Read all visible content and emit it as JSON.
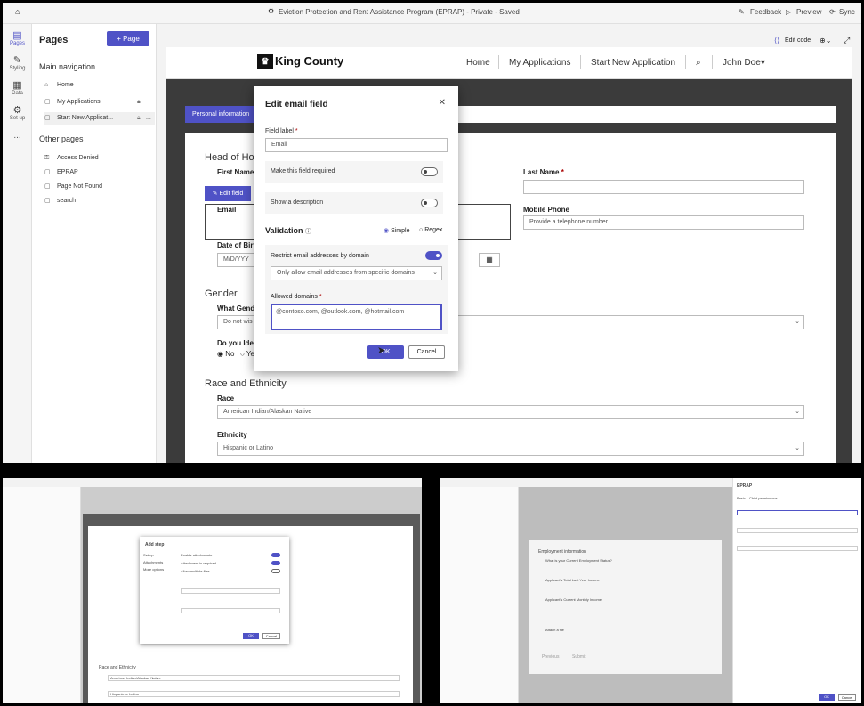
{
  "topbar": {
    "title": "Eviction Protection and Rent Assistance Program (EPRAP) - Private - Saved",
    "feedback": "Feedback",
    "preview": "Preview",
    "sync": "Sync"
  },
  "rail": {
    "pages": "Pages",
    "styling": "Styling",
    "data": "Data",
    "setup": "Set up",
    "more": "..."
  },
  "pages_panel": {
    "title": "Pages",
    "add_button": "+ Page",
    "main_nav": "Main navigation",
    "main_items": [
      "Home",
      "My Applications",
      "Start New Applicat..."
    ],
    "more_icon": "...",
    "other": "Other pages",
    "other_items": [
      "Access Denied",
      "EPRAP",
      "Page Not Found",
      "search"
    ]
  },
  "canvas": {
    "edit_code": "Edit code",
    "logo": "King County",
    "nav": [
      "Home",
      "My Applications",
      "Start New Application"
    ],
    "user": "John Doe",
    "step_tab": "Personal information"
  },
  "form": {
    "head": "Head of Hous",
    "first_name": "First Name",
    "edit_field": "Edit field",
    "last_name": "Last Name",
    "required": "*",
    "email": "Email",
    "mobile_phone": "Mobile Phone",
    "mobile_placeholder": "Provide a telephone number",
    "dob": "Date of Birt",
    "dob_placeholder": "M/D/YYY",
    "gender_section": "Gender",
    "gender_q": "What Gend",
    "gender_value": "Do not wis",
    "trans_q": "Do you Ide",
    "no": "No",
    "yes": "Ye",
    "race_section": "Race and Ethnicity",
    "race": "Race",
    "race_value": "American Indian/Alaskan Native",
    "ethnicity": "Ethnicity",
    "ethnicity_value": "Hispanic or Latino"
  },
  "dialog": {
    "title": "Edit email field",
    "field_label": "Field label",
    "field_value": "Email",
    "required_toggle": "Make this field required",
    "desc_toggle": "Show a description",
    "validation": "Validation",
    "simple": "Simple",
    "regex": "Regex",
    "restrict": "Restrict email addresses by domain",
    "dropdown": "Only allow email addresses from specific domains",
    "allowed_domains": "Allowed domains",
    "domains_value": "@contoso.com, @outlook.com, @hotmail.com",
    "ok": "OK",
    "cancel": "Cancel"
  },
  "thumb1": {
    "dialog_title": "Add step",
    "tabs": [
      "Set up",
      "Attachments",
      "More options"
    ],
    "rows": [
      "Enable attachments",
      "Attachment is required",
      "Allow multiple files"
    ],
    "ok": "OK",
    "cancel": "Cancel",
    "section": "Race and Ethnicity",
    "race_value": "American Indian/Alaskan Native",
    "ethnicity_value": "Hispanic or Latino"
  },
  "thumb2": {
    "panel_title": "EPRAP",
    "tabs": [
      "Basic",
      "Child permissions"
    ],
    "section": "Employment information",
    "fields": [
      "What is your Current Employment Status?",
      "Applicant's Total Last Year Income",
      "Applicant's Current Monthly Income"
    ],
    "attach": "Attach a file",
    "buttons": [
      "Previous",
      "Submit"
    ],
    "ok": "OK",
    "cancel": "Cancel"
  }
}
